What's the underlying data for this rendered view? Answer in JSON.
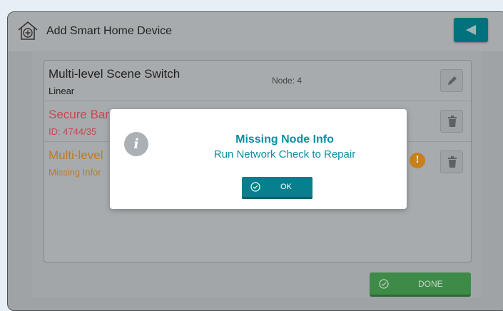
{
  "window": {
    "title": "Add Smart Home Device"
  },
  "devices": [
    {
      "name": "Multi-level Scene Switch",
      "subtitle": "Linear",
      "node": "Node: 4",
      "name_color": "#222222",
      "sub_color": "#222222"
    },
    {
      "name": "Secure Bar",
      "subtitle": "ID: 4744/35",
      "name_color": "#c24a52",
      "sub_color": "#c24a52"
    },
    {
      "name": "Multi-level",
      "subtitle": "Missing Infor",
      "name_color": "#c07a21",
      "sub_color": "#c07a21"
    }
  ],
  "modal": {
    "title": "Missing Node Info",
    "message": "Run Network Check to Repair",
    "ok_label": "OK"
  },
  "footer": {
    "done_label": "DONE"
  },
  "colors": {
    "accent": "#0b8fa3",
    "ok_button": "#087f8c",
    "done_button": "#3e8b48",
    "warning": "#c87f1c",
    "error": "#c24a52"
  },
  "icons": [
    "home-add-icon",
    "back-arrow-icon",
    "pencil-icon",
    "trash-icon",
    "info-icon",
    "warning-icon",
    "check-circle-icon"
  ]
}
